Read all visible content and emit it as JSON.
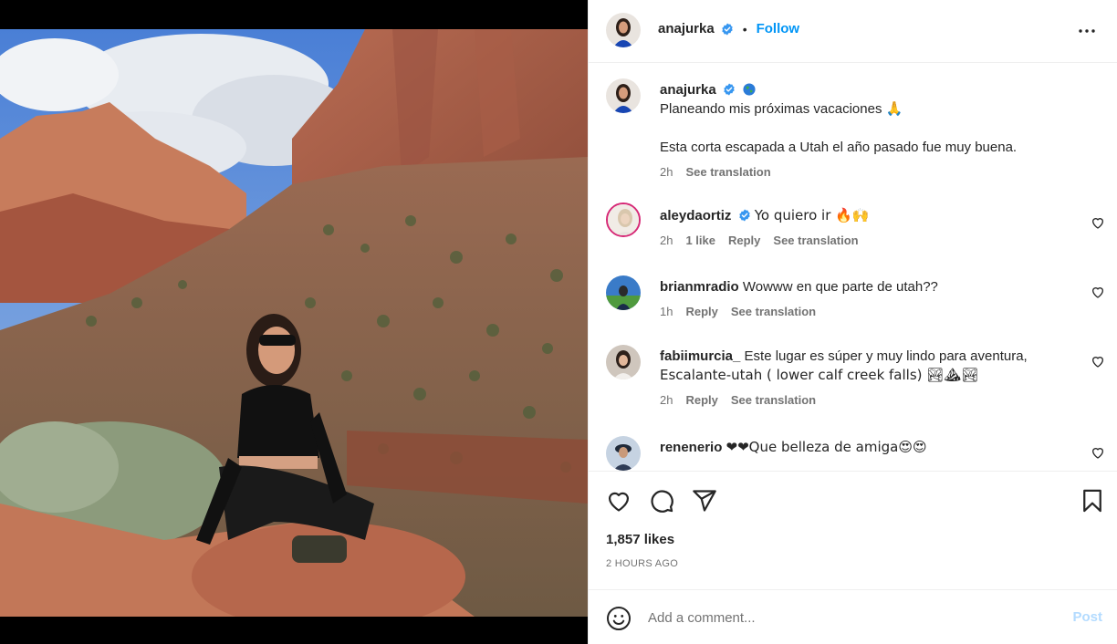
{
  "post": {
    "author": "anajurka",
    "follow_label": "Follow",
    "separator": "•",
    "caption_author": "anajurka",
    "caption_line1": "Planeando mis próximas vacaciones 🙏",
    "caption_line2": "Esta corta escapada a Utah el año pasado fue muy buena.",
    "caption_time": "2h",
    "caption_translate": "See translation",
    "likes": "1,857 likes",
    "time_ago": "2 HOURS AGO",
    "add_comment_placeholder": "Add a comment...",
    "post_label": "Post"
  },
  "comments": [
    {
      "user": "aleydaortiz",
      "text": "Yo quiero ir 🔥🙌",
      "time": "2h",
      "likes": "1 like",
      "reply": "Reply",
      "translate": "See translation"
    },
    {
      "user": "brianmradio",
      "text": "Wowww en que parte de utah??",
      "time": "1h",
      "reply": "Reply",
      "translate": "See translation"
    },
    {
      "user": "fabiimurcia_",
      "text": "Este lugar es súper y muy lindo para aventura,",
      "text2": "Escalante-utah ( lower calf creek falls) 🏞⛰🏞",
      "time": "2h",
      "reply": "Reply",
      "translate": "See translation"
    },
    {
      "user": "renenerio",
      "text": "❤❤Que belleza de amiga😍😍"
    }
  ],
  "colors": {
    "accent": "#0095f6",
    "verified": "#3897f0",
    "muted": "#737373",
    "post_disabled": "#b3dbff"
  },
  "icons": [
    "verified-badge-icon",
    "globe-icon",
    "more-options-icon",
    "heart-icon",
    "comment-icon",
    "share-icon",
    "bookmark-icon",
    "emoji-icon"
  ]
}
